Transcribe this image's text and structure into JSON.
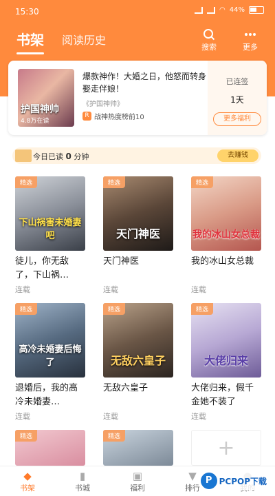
{
  "status": {
    "time": "15:30",
    "battery": "44%"
  },
  "header": {
    "tabs": [
      "书架",
      "阅读历史"
    ],
    "search_label": "搜索",
    "more_label": "更多"
  },
  "promo": {
    "cover_title": "护国神帅",
    "cover_reads": "4.8万在读",
    "desc": "爆款神作！大婚之日，他怒而转身娶走伴娘！",
    "source": "《护国神帅》",
    "rank": "战神热度榜前10",
    "sign_label": "已连签",
    "sign_days": "1天",
    "more_benefits": "更多福利"
  },
  "reading": {
    "prefix": "今日已读",
    "minutes": "0",
    "unit": "分钟",
    "earn": "去赚钱"
  },
  "books": [
    {
      "tag": "精选",
      "cover_text": "下山祸害未婚妻吧",
      "title": "徒儿，你无敌了，下山祸…",
      "status": "连载"
    },
    {
      "tag": "精选",
      "cover_text": "天门神医",
      "title": "天门神医",
      "status": "连载"
    },
    {
      "tag": "精选",
      "cover_text": "我的冰山女总裁",
      "title": "我的冰山女总裁",
      "status": "连载"
    },
    {
      "tag": "精选",
      "cover_text": "高冷未婚妻后悔了",
      "title": "退婚后，我的高冷未婚妻…",
      "status": "连载"
    },
    {
      "tag": "精选",
      "cover_text": "无敌六皇子",
      "title": "无敌六皇子",
      "status": "连载"
    },
    {
      "tag": "精选",
      "cover_text": "大佬归来",
      "title": "大佬归来，假千金她不装了",
      "status": "连载"
    },
    {
      "tag": "精选",
      "cover_text": "",
      "title": "",
      "status": ""
    },
    {
      "tag": "精选",
      "cover_text": "",
      "title": "",
      "status": ""
    }
  ],
  "add_icon": "plus-icon",
  "nav": [
    "书架",
    "书城",
    "福利",
    "排行",
    "我的"
  ],
  "watermark": {
    "mark": "P",
    "text": "PCPOP下载"
  },
  "colors": {
    "accent": "#ff8a3d",
    "tag": "#f6a065"
  }
}
